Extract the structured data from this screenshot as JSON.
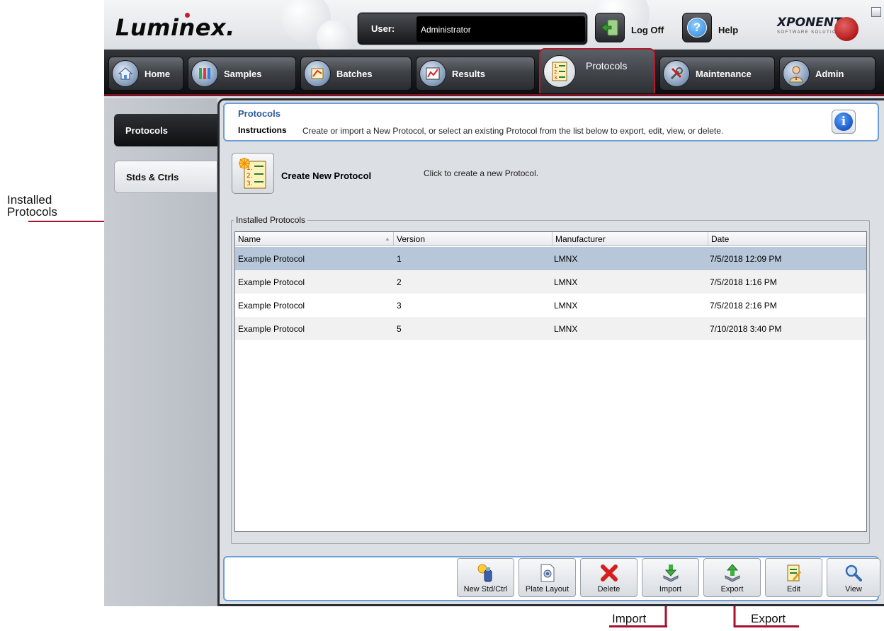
{
  "annotations": {
    "installed_protocols_line1": "Installed",
    "installed_protocols_line2": "Protocols",
    "import": "Import",
    "export": "Export"
  },
  "app": {
    "logo": "Luminex.",
    "user_label": "User:",
    "user_value": "Administrator",
    "logoff_label": "Log Off",
    "help_label": "Help",
    "brand": "XPONENT.",
    "brand_sub": "SOFTWARE SOLUTIONS"
  },
  "nav": {
    "tabs": [
      {
        "label": "Home",
        "icon": "home-icon"
      },
      {
        "label": "Samples",
        "icon": "samples-icon"
      },
      {
        "label": "Batches",
        "icon": "batches-icon"
      },
      {
        "label": "Results",
        "icon": "results-icon"
      },
      {
        "label": "Protocols",
        "icon": "protocols-icon",
        "active": true
      },
      {
        "label": "Maintenance",
        "icon": "maintenance-icon"
      },
      {
        "label": "Admin",
        "icon": "admin-icon"
      }
    ]
  },
  "subnav": {
    "items": [
      {
        "label": "Protocols",
        "active": true
      },
      {
        "label": "Stds & Ctrls",
        "active": false
      }
    ]
  },
  "header": {
    "title": "Protocols",
    "instructions_label": "Instructions",
    "instructions_text": "Create or import a New Protocol, or select an existing Protocol from the list below to export, edit, view, or delete."
  },
  "create": {
    "label": "Create New Protocol",
    "description": "Click to create a new Protocol."
  },
  "installed": {
    "legend": "Installed Protocols",
    "columns": [
      "Name",
      "Version",
      "Manufacturer",
      "Date"
    ],
    "rows": [
      {
        "name": "Example Protocol",
        "version": "1",
        "manufacturer": "LMNX",
        "date": "7/5/2018 12:09 PM",
        "selected": true
      },
      {
        "name": "Example Protocol",
        "version": "2",
        "manufacturer": "LMNX",
        "date": "7/5/2018 1:16 PM",
        "selected": false
      },
      {
        "name": "Example Protocol",
        "version": "3",
        "manufacturer": "LMNX",
        "date": "7/5/2018 2:16 PM",
        "selected": false
      },
      {
        "name": "Example Protocol",
        "version": "5",
        "manufacturer": "LMNX",
        "date": "7/10/2018 3:40 PM",
        "selected": false
      }
    ]
  },
  "toolbar": {
    "buttons": [
      {
        "label": "New Std/Ctrl",
        "icon": "new-std-ctrl-icon"
      },
      {
        "label": "Plate Layout",
        "icon": "plate-layout-icon"
      },
      {
        "label": "Delete",
        "icon": "delete-icon"
      },
      {
        "label": "Import",
        "icon": "import-icon"
      },
      {
        "label": "Export",
        "icon": "export-icon"
      },
      {
        "label": "Edit",
        "icon": "edit-icon"
      },
      {
        "label": "View",
        "icon": "view-icon"
      }
    ]
  },
  "colors": {
    "annotation_arrow": "#a6122e",
    "header_border": "#6c9fd8",
    "selected_row": "#b7c7d9",
    "alt_row": "#f1f1f2"
  }
}
